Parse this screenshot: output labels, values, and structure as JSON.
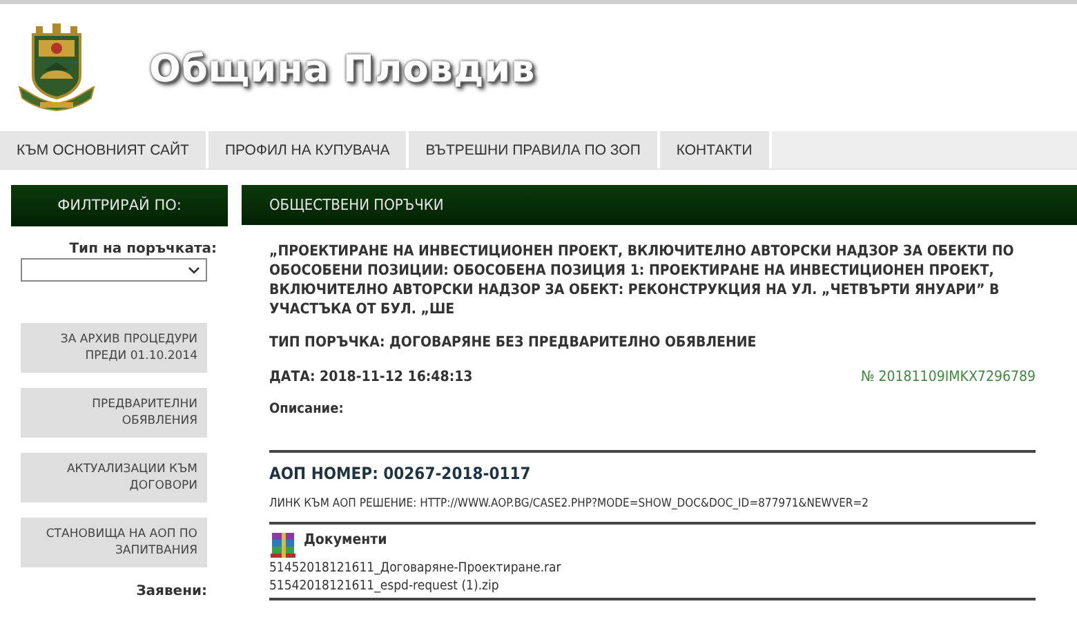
{
  "header": {
    "title": "Община Пловдив"
  },
  "nav": [
    {
      "label": "КЪМ ОСНОВНИЯТ САЙТ"
    },
    {
      "label": "ПРОФИЛ НА КУПУВАЧА"
    },
    {
      "label": "ВЪТРЕШНИ ПРАВИЛА ПО ЗОП"
    },
    {
      "label": "КОНТАКТИ"
    }
  ],
  "filter": {
    "heading": "ФИЛТРИРАЙ ПО:",
    "type_label": "Тип на поръчката:",
    "links": [
      {
        "label": "ЗА АРХИВ ПРОЦЕДУРИ ПРЕДИ 01.10.2014"
      },
      {
        "label": "ПРЕДВАРИТЕЛНИ ОБЯВЛЕНИЯ"
      },
      {
        "label": "АКТУАЛИЗАЦИИ КЪМ ДОГОВОРИ"
      },
      {
        "label": "СТАНОВИЩА НА АОП ПО ЗАПИТВАНИЯ"
      }
    ],
    "footer_label": "Заявени:"
  },
  "main": {
    "heading": "ОБЩЕСТВЕНИ ПОРЪЧКИ",
    "title": "„ПРОЕКТИРАНЕ НА ИНВЕСТИЦИОНЕН ПРОЕКТ, ВКЛЮЧИТЕЛНО АВТОРСКИ НАДЗОР ЗА ОБЕКТИ ПО ОБОСОБЕНИ ПОЗИЦИИ: ОБОСОБЕНА ПОЗИЦИЯ 1: ПРОЕКТИРАНЕ НА ИНВЕСТИЦИОНЕН ПРОЕКТ, ВКЛЮЧИТЕЛНО АВТОРСКИ НАДЗОР ЗА ОБЕКТ: РЕКОНСТРУКЦИЯ НА УЛ. „ЧЕТВЪРТИ ЯНУАРИ” В УЧАСТЪКА ОТ БУЛ. „ШЕ",
    "type": "ТИП ПОРЪЧКА: ДОГОВАРЯНЕ БЕЗ ПРЕДВАРИТЕЛНО ОБЯВЛЕНИЕ",
    "date": "ДАТА: 2018-11-12 16:48:13",
    "number": "№ 20181109IMKX7296789",
    "description_label": "Описание:",
    "aop_number": "АОП НОМЕР: 00267-2018-0117",
    "aop_link": "ЛИНК КЪМ АОП РЕШЕНИЕ: HTTP://WWW.AOP.BG/CASE2.PHP?MODE=SHOW_DOC&DOC_ID=877971&NEWVER=2",
    "documents_heading": "Документи",
    "files": [
      {
        "name": "51452018121611_Договаряне-Проектиране.rar"
      },
      {
        "name": "51542018121611_espd-request (1).zip"
      }
    ]
  }
}
